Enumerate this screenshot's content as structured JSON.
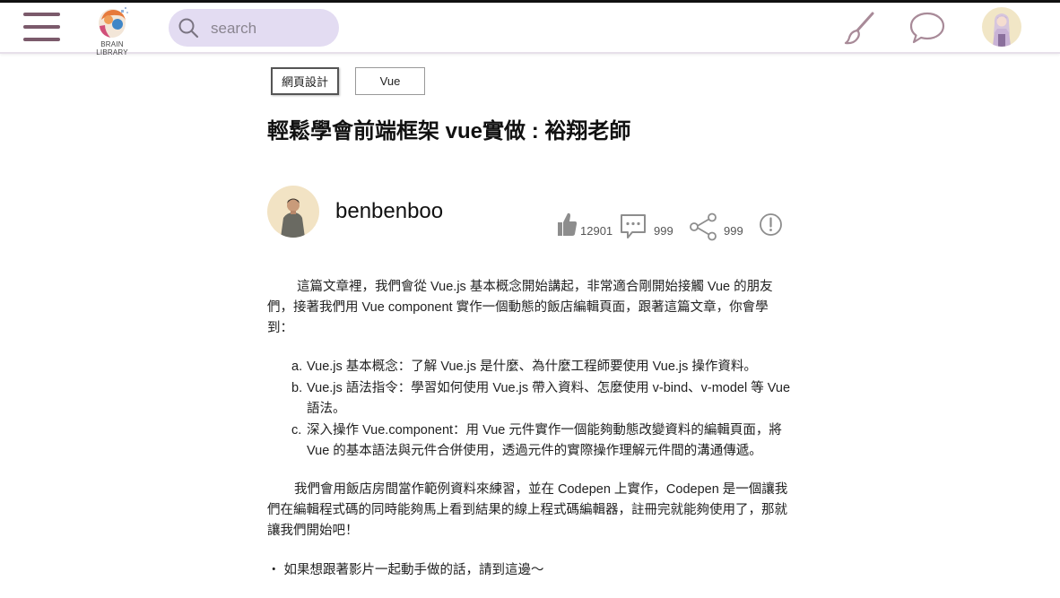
{
  "header": {
    "logo_text": "BRAIN LIBRARY",
    "search_placeholder": "search",
    "icons": [
      "menu-icon",
      "search-icon",
      "brush-icon",
      "chat-icon",
      "avatar"
    ]
  },
  "colors": {
    "accent": "#7b5a6b",
    "search_bg": "#e3dcf2",
    "icon_mauve": "#a88a98"
  },
  "article": {
    "tags": [
      "網頁設計",
      "Vue"
    ],
    "title": "輕鬆學會前端框架 vue實做 : 裕翔老師",
    "author": "benbenboo",
    "stats": {
      "likes": "12901",
      "comments": "999",
      "shares": "999"
    },
    "intro": "這篇文章裡，我們會從 Vue.js 基本概念開始講起，非常適合剛開始接觸 Vue 的朋友們，接著我們用 Vue component 實作一個動態的飯店編輯頁面，跟著這篇文章，你會學到：",
    "list": [
      {
        "marker": "a.",
        "text": "Vue.js 基本概念：了解 Vue.js 是什麼、為什麼工程師要使用 Vue.js 操作資料。"
      },
      {
        "marker": "b.",
        "text": "Vue.js 語法指令：學習如何使用 Vue.js 帶入資料、怎麼使用 v-bind、v-model 等 Vue 語法。"
      },
      {
        "marker": "c.",
        "text": "深入操作 Vue.component：用 Vue 元件實作一個能夠動態改變資料的編輯頁面，將 Vue 的基本語法與元件合併使用，透過元件的實際操作理解元件間的溝通傳遞。"
      }
    ],
    "para2": "我們會用飯店房間當作範例資料來練習，並在 Codepen 上實作，Codepen 是一個讓我們在編輯程式碼的同時能夠馬上看到結果的線上程式碼編輯器，註冊完就能夠使用了，那就讓我們開始吧！",
    "para3": "・ 如果想跟著影片一起動手做的話，請到這邊～"
  }
}
